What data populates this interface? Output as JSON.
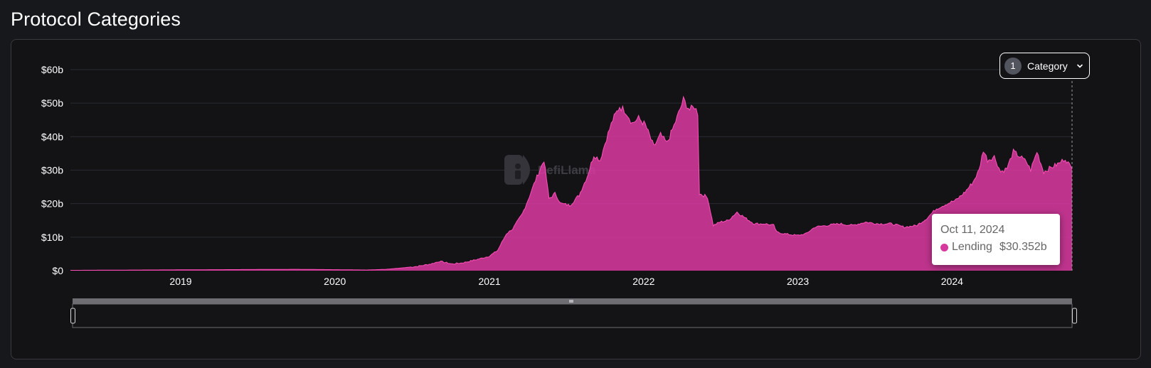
{
  "page": {
    "title": "Protocol Categories"
  },
  "category_filter": {
    "count": "1",
    "label": "Category",
    "icon": "chevron-down-icon"
  },
  "watermark": {
    "text": "DefiLlama"
  },
  "tooltip": {
    "date": "Oct 11, 2024",
    "series": "Lending",
    "value": "$30.352b"
  },
  "colors": {
    "series": "#d6399e",
    "background": "#131316",
    "grid": "#2a2b31"
  },
  "chart_data": {
    "type": "area",
    "y_unit": "billions USD",
    "yticks": [
      "$0",
      "$10b",
      "$20b",
      "$30b",
      "$40b",
      "$50b",
      "$60b"
    ],
    "ylim": [
      0,
      60
    ],
    "xticks": [
      "2019",
      "2020",
      "2021",
      "2022",
      "2023",
      "2024"
    ],
    "xlim": [
      "2018-04-15",
      "2024-10-11"
    ],
    "grid": true,
    "series": [
      {
        "name": "Lending",
        "color": "#d6399e",
        "points": [
          [
            "2018-04-15",
            0.1
          ],
          [
            "2018-10-01",
            0.2
          ],
          [
            "2019-04-01",
            0.3
          ],
          [
            "2019-10-01",
            0.4
          ],
          [
            "2020-01-01",
            0.3
          ],
          [
            "2020-03-15",
            0.2
          ],
          [
            "2020-05-01",
            0.4
          ],
          [
            "2020-06-15",
            0.9
          ],
          [
            "2020-07-15",
            1.3
          ],
          [
            "2020-08-15",
            2.0
          ],
          [
            "2020-09-05",
            2.8
          ],
          [
            "2020-10-05",
            2.0
          ],
          [
            "2020-11-01",
            2.4
          ],
          [
            "2020-12-01",
            3.3
          ],
          [
            "2020-12-31",
            4.3
          ],
          [
            "2021-01-20",
            6.0
          ],
          [
            "2021-02-10",
            11.0
          ],
          [
            "2021-02-25",
            12.5
          ],
          [
            "2021-03-20",
            17.0
          ],
          [
            "2021-04-05",
            22.0
          ],
          [
            "2021-04-20",
            27.0
          ],
          [
            "2021-05-10",
            33.0
          ],
          [
            "2021-05-22",
            21.5
          ],
          [
            "2021-06-05",
            23.0
          ],
          [
            "2021-06-20",
            20.0
          ],
          [
            "2021-07-10",
            19.5
          ],
          [
            "2021-08-01",
            22.5
          ],
          [
            "2021-08-20",
            28.0
          ],
          [
            "2021-09-05",
            34.5
          ],
          [
            "2021-09-20",
            33.0
          ],
          [
            "2021-10-05",
            39.5
          ],
          [
            "2021-10-20",
            45.0
          ],
          [
            "2021-11-05",
            49.0
          ],
          [
            "2021-11-20",
            47.5
          ],
          [
            "2021-12-05",
            44.0
          ],
          [
            "2021-12-20",
            45.5
          ],
          [
            "2022-01-05",
            43.5
          ],
          [
            "2022-01-25",
            37.0
          ],
          [
            "2022-02-10",
            40.5
          ],
          [
            "2022-02-25",
            38.0
          ],
          [
            "2022-03-10",
            42.0
          ],
          [
            "2022-03-25",
            47.0
          ],
          [
            "2022-04-05",
            51.0
          ],
          [
            "2022-04-20",
            48.0
          ],
          [
            "2022-05-01",
            49.0
          ],
          [
            "2022-05-09",
            47.0
          ],
          [
            "2022-05-13",
            23.0
          ],
          [
            "2022-06-01",
            22.0
          ],
          [
            "2022-06-15",
            13.5
          ],
          [
            "2022-07-01",
            14.5
          ],
          [
            "2022-07-20",
            15.0
          ],
          [
            "2022-08-10",
            17.5
          ],
          [
            "2022-09-01",
            15.5
          ],
          [
            "2022-09-20",
            14.0
          ],
          [
            "2022-10-15",
            14.0
          ],
          [
            "2022-11-05",
            13.5
          ],
          [
            "2022-11-12",
            11.5
          ],
          [
            "2022-12-01",
            11.0
          ],
          [
            "2022-12-30",
            10.5
          ],
          [
            "2023-01-20",
            11.0
          ],
          [
            "2023-02-10",
            13.0
          ],
          [
            "2023-03-10",
            13.5
          ],
          [
            "2023-04-10",
            14.0
          ],
          [
            "2023-05-10",
            13.5
          ],
          [
            "2023-06-10",
            14.5
          ],
          [
            "2023-07-10",
            14.0
          ],
          [
            "2023-08-10",
            14.0
          ],
          [
            "2023-09-10",
            13.0
          ],
          [
            "2023-10-10",
            13.5
          ],
          [
            "2023-11-01",
            15.5
          ],
          [
            "2023-11-25",
            18.5
          ],
          [
            "2023-12-20",
            20.0
          ],
          [
            "2024-01-10",
            21.0
          ],
          [
            "2024-02-01",
            23.5
          ],
          [
            "2024-02-20",
            26.5
          ],
          [
            "2024-03-05",
            30.0
          ],
          [
            "2024-03-15",
            36.0
          ],
          [
            "2024-03-25",
            33.0
          ],
          [
            "2024-04-10",
            34.0
          ],
          [
            "2024-04-25",
            29.5
          ],
          [
            "2024-05-10",
            30.5
          ],
          [
            "2024-05-25",
            35.5
          ],
          [
            "2024-06-10",
            34.0
          ],
          [
            "2024-06-25",
            32.5
          ],
          [
            "2024-07-05",
            30.0
          ],
          [
            "2024-07-20",
            35.5
          ],
          [
            "2024-08-05",
            29.5
          ],
          [
            "2024-08-25",
            31.0
          ],
          [
            "2024-09-10",
            32.0
          ],
          [
            "2024-09-25",
            33.5
          ],
          [
            "2024-10-05",
            31.5
          ],
          [
            "2024-10-11",
            30.352
          ]
        ]
      }
    ]
  }
}
